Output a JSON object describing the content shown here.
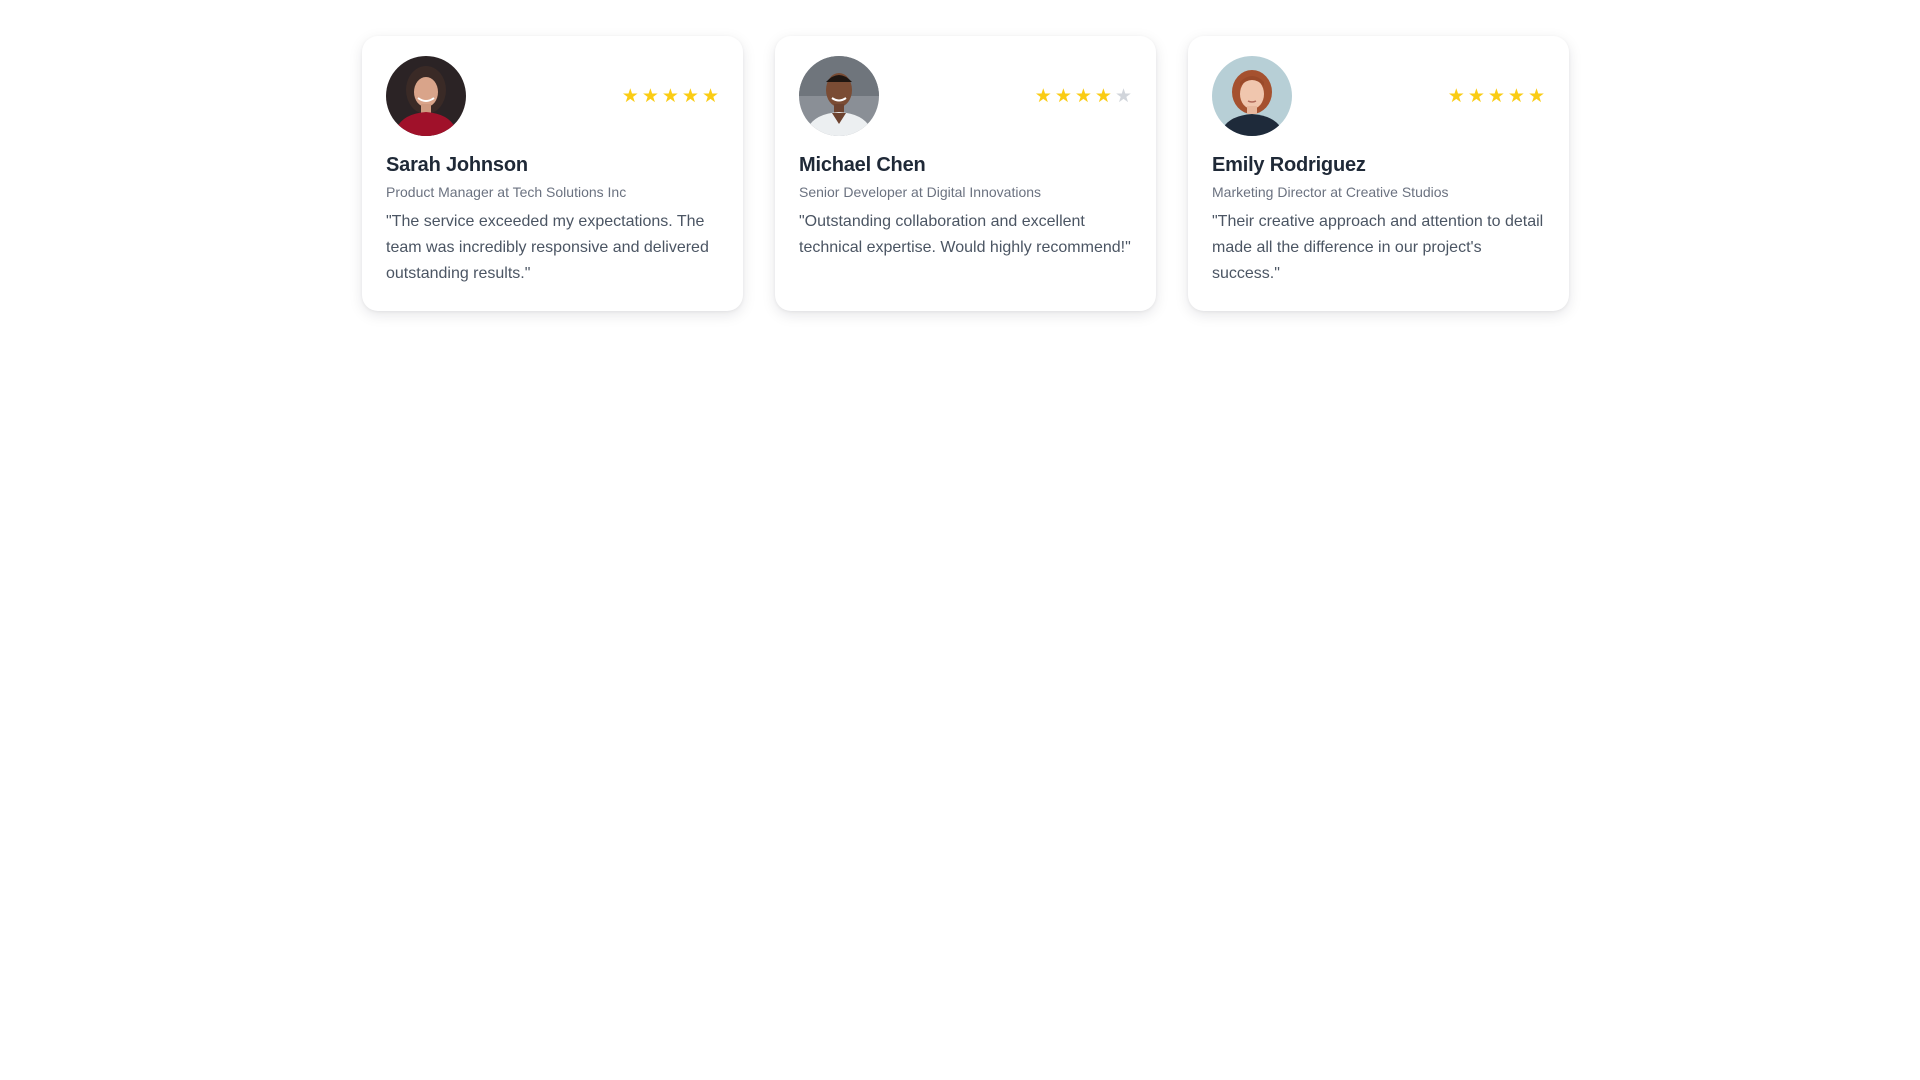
{
  "colors": {
    "star_filled": "#facc15",
    "star_empty": "#d1d5db",
    "name": "#1f2937",
    "role": "#6b7280",
    "quote": "#4b5563"
  },
  "testimonials": [
    {
      "name": "Sarah Johnson",
      "role": "Product Manager at Tech Solutions Inc",
      "quote": "\"The service exceeded my expectations. The team was incredibly responsive and delivered outstanding results.\"",
      "rating": 5,
      "rating_max": 5,
      "avatar_icon": "avatar-photo"
    },
    {
      "name": "Michael Chen",
      "role": "Senior Developer at Digital Innovations",
      "quote": "\"Outstanding collaboration and excellent technical expertise. Would highly recommend!\"",
      "rating": 4,
      "rating_max": 5,
      "avatar_icon": "avatar-photo"
    },
    {
      "name": "Emily Rodriguez",
      "role": "Marketing Director at Creative Studios",
      "quote": "\"Their creative approach and attention to detail made all the difference in our project's success.\"",
      "rating": 5,
      "rating_max": 5,
      "avatar_icon": "avatar-photo"
    }
  ]
}
